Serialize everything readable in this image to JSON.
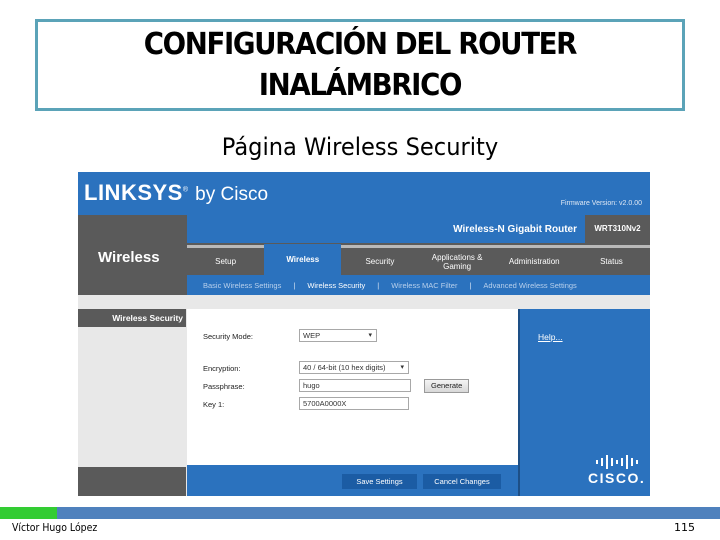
{
  "slide": {
    "title_line1": "CONFIGURACIÓN DEL ROUTER",
    "title_line2": "INALÁMBRICO",
    "subtitle": "Página Wireless Security",
    "author": "Víctor Hugo López",
    "page_number": "115",
    "accent_colors": {
      "border": "#5ba3b8",
      "footer_blue": "#4f81bd",
      "footer_green": "#33cc33"
    }
  },
  "router": {
    "brand": "LINKSYS",
    "brand_suffix": "by Cisco",
    "firmware": "Firmware Version: v2.0.00",
    "product_name": "Wireless-N Gigabit Router",
    "model": "WRT310Nv2",
    "section": "Wireless",
    "tabs": [
      {
        "label": "Setup",
        "active": false
      },
      {
        "label": "Wireless",
        "active": true
      },
      {
        "label": "Security",
        "active": false
      },
      {
        "label": "Applications & Gaming",
        "active": false
      },
      {
        "label": "Administration",
        "active": false
      },
      {
        "label": "Status",
        "active": false
      }
    ],
    "subtabs": [
      {
        "label": "Basic Wireless Settings",
        "active": false
      },
      {
        "label": "Wireless Security",
        "active": true
      },
      {
        "label": "Wireless MAC Filter",
        "active": false
      },
      {
        "label": "Advanced Wireless Settings",
        "active": false
      }
    ],
    "side_heading": "Wireless Security",
    "form": {
      "security_mode_label": "Security Mode:",
      "security_mode_value": "WEP",
      "encryption_label": "Encryption:",
      "encryption_value": "40 / 64-bit (10 hex digits)",
      "passphrase_label": "Passphrase:",
      "passphrase_value": "hugo",
      "generate_label": "Generate",
      "key1_label": "Key 1:",
      "key1_value": "5700A0000X"
    },
    "help_link": "Help...",
    "cisco_word": "CISCO.",
    "save_label": "Save Settings",
    "cancel_label": "Cancel Changes",
    "brand_color": "#2b72be"
  }
}
